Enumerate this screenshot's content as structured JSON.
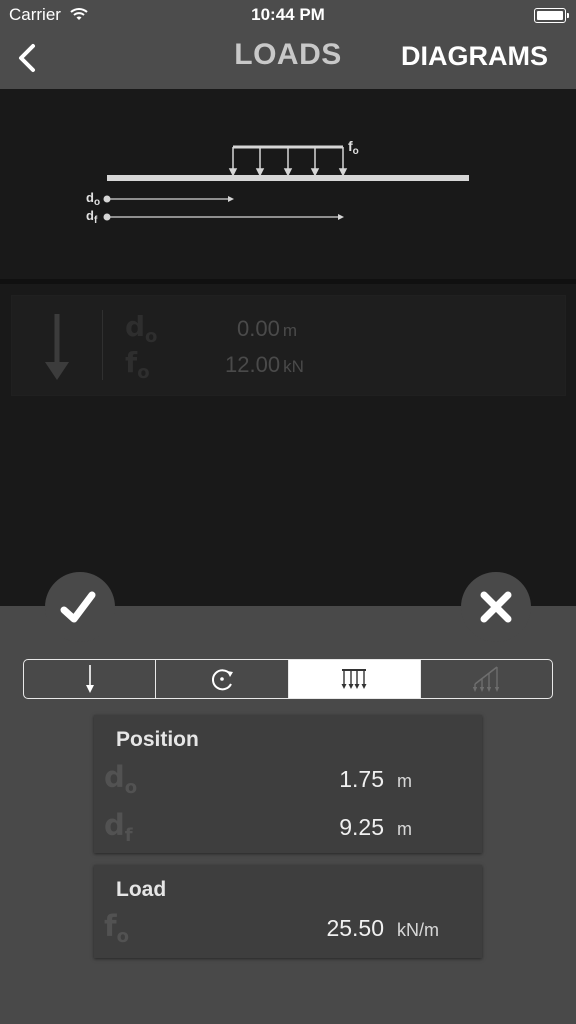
{
  "status_bar": {
    "carrier": "Carrier",
    "time": "10:44 PM"
  },
  "nav": {
    "title": "LOADS",
    "right_button": "DIAGRAMS"
  },
  "diagram": {
    "load_label": "f",
    "load_sub": "o",
    "d0_label": "d",
    "d0_sub": "o",
    "df_label": "d",
    "df_sub": "f"
  },
  "existing_load": {
    "icon": "arrow-down-icon",
    "d0_label": "d",
    "d0_sub": "o",
    "f0_label": "f",
    "f0_sub": "o",
    "position_value": "0.00",
    "position_unit": "m",
    "force_value": "12.00",
    "force_unit": "kN"
  },
  "actions": {
    "confirm_icon": "checkmark-icon",
    "cancel_icon": "close-icon"
  },
  "load_types": [
    {
      "icon": "point-load-icon",
      "selected": false
    },
    {
      "icon": "moment-load-icon",
      "selected": false
    },
    {
      "icon": "distributed-load-icon",
      "selected": true
    },
    {
      "icon": "triangular-load-icon",
      "selected": false
    }
  ],
  "position": {
    "title": "Position",
    "d0_label": "d",
    "d0_sub": "o",
    "d0_value": "1.75",
    "d0_unit": "m",
    "df_label": "d",
    "df_sub": "f",
    "df_value": "9.25",
    "df_unit": "m"
  },
  "load": {
    "title": "Load",
    "f0_label": "f",
    "f0_sub": "o",
    "f0_value": "25.50",
    "f0_unit": "kN/m"
  },
  "colors": {
    "nav_bg": "#4c4c4c",
    "canvas_bg": "#191919",
    "panel_bg": "#494949",
    "card_bg": "#3e3e3e"
  }
}
